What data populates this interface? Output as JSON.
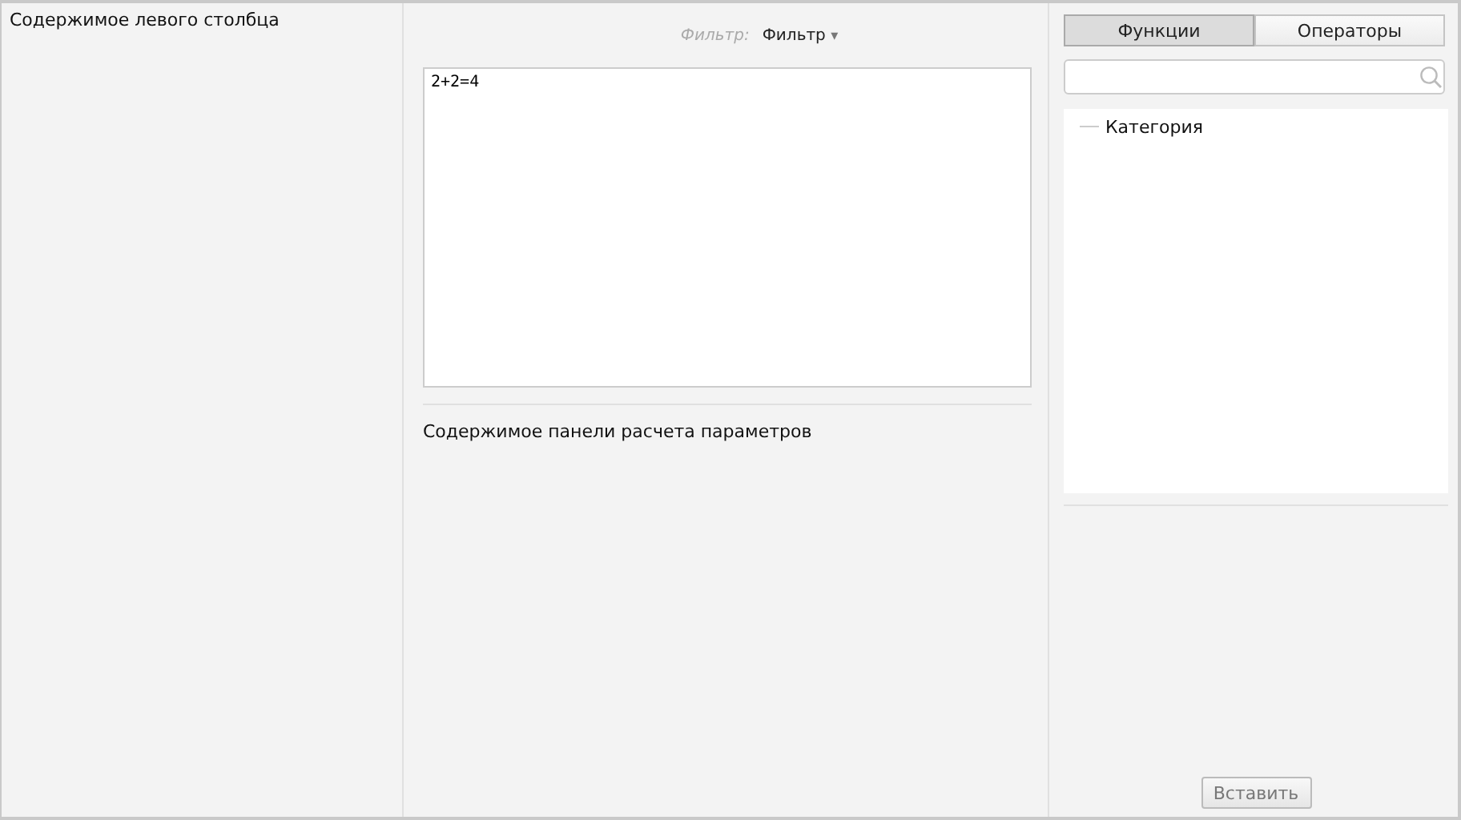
{
  "left_column": {
    "text": "Содержимое левого столбца"
  },
  "filter": {
    "label": "Фильтр:",
    "value": "Фильтр",
    "caret": "▾"
  },
  "editor": {
    "value": "2+2=4"
  },
  "parameters_panel": {
    "text": "Содержимое панели расчета параметров"
  },
  "tabs": [
    {
      "label": "Функции",
      "selected": true
    },
    {
      "label": "Операторы",
      "selected": false
    }
  ],
  "tree": [
    {
      "label": "Категория"
    }
  ],
  "insert_button": {
    "label": "Вставить",
    "disabled": true
  }
}
